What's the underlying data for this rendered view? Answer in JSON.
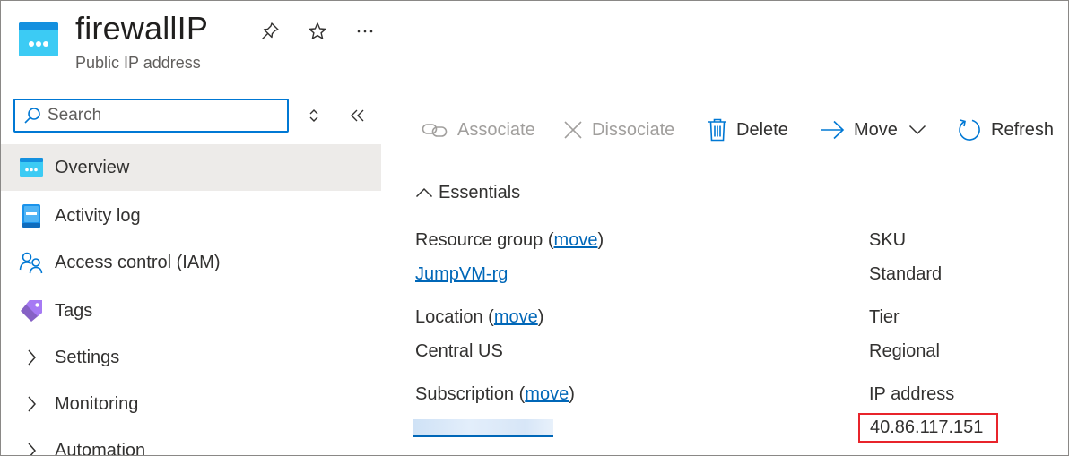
{
  "header": {
    "title": "firewallIP",
    "subtitle": "Public IP address",
    "icons": [
      "public-ip-icon",
      "pin-icon",
      "star-icon",
      "more-icon"
    ]
  },
  "search": {
    "placeholder": "Search",
    "value": ""
  },
  "sidebar": {
    "items": [
      {
        "label": "Overview",
        "icon": "public-ip-icon",
        "active": true
      },
      {
        "label": "Activity log",
        "icon": "activity-log-icon"
      },
      {
        "label": "Access control (IAM)",
        "icon": "people-icon"
      },
      {
        "label": "Tags",
        "icon": "tag-icon"
      },
      {
        "label": "Settings",
        "icon": "chevron-right-icon"
      },
      {
        "label": "Monitoring",
        "icon": "chevron-right-icon"
      },
      {
        "label": "Automation",
        "icon": "chevron-right-icon"
      }
    ]
  },
  "toolbar": {
    "associate": "Associate",
    "dissociate": "Dissociate",
    "delete": "Delete",
    "move": "Move",
    "refresh": "Refresh"
  },
  "essentials": {
    "heading": "Essentials",
    "resource_group_label": "Resource group",
    "resource_group_value": "JumpVM-rg",
    "location_label": "Location",
    "location_value": "Central US",
    "subscription_label": "Subscription",
    "move_link": "move",
    "sku_label": "SKU",
    "sku_value": "Standard",
    "tier_label": "Tier",
    "tier_value": "Regional",
    "ip_label": "IP address",
    "ip_value": "40.86.117.151"
  },
  "colors": {
    "accent": "#0078d4",
    "link": "#0067b8",
    "highlight_border": "#e8242b",
    "active_nav": "#edebe9",
    "disabled_text": "#a19f9d"
  }
}
